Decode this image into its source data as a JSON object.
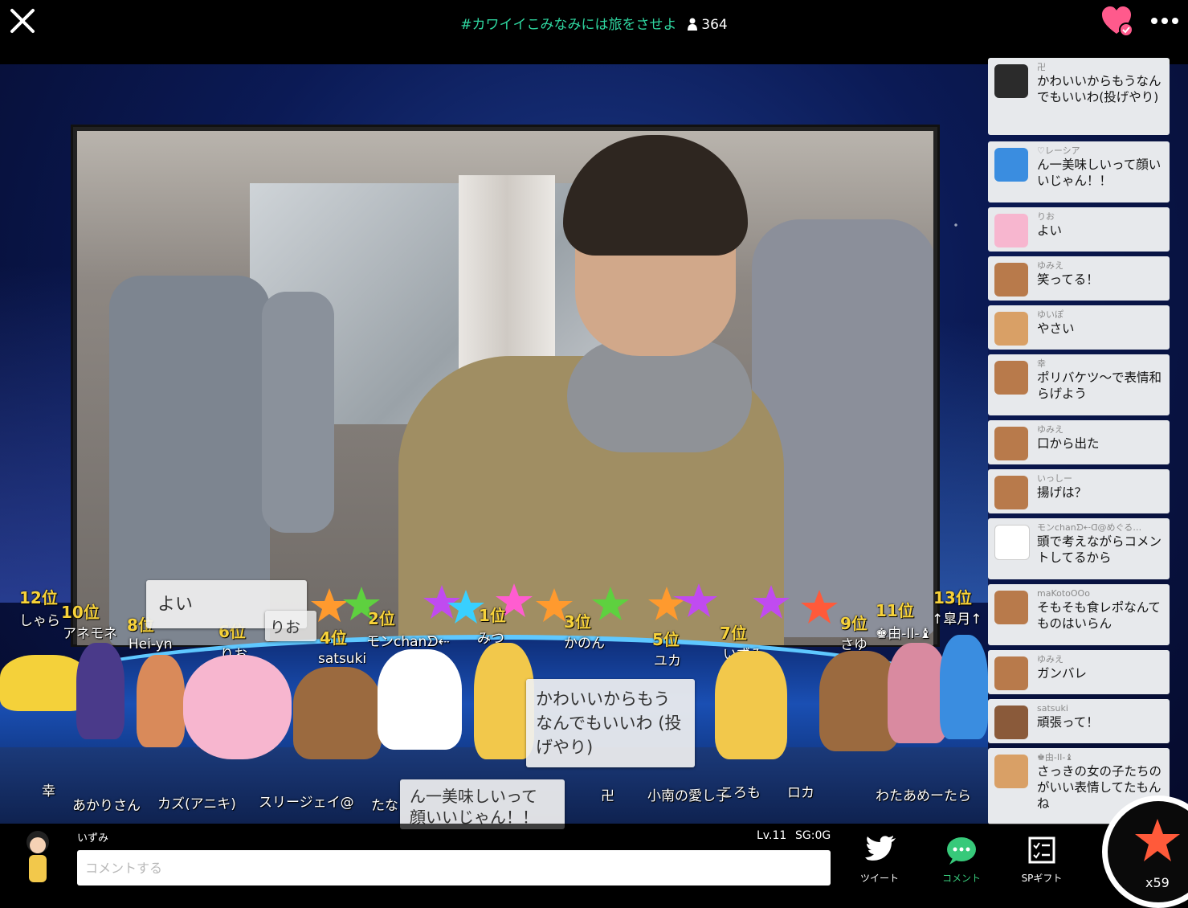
{
  "header": {
    "title": "#カワイイこみなみには旅をさせよ",
    "viewer_count": "364"
  },
  "comments": [
    {
      "name": "卍",
      "text": "かわいいからもうなんでもいいわ(投げやり)",
      "avatar": "sushi-avatar",
      "color": "#2b2b2b"
    },
    {
      "name": "♡レーシア",
      "text": "ん一美味しいって顔いいじゃん！！",
      "avatar": "penguin-avatar",
      "color": "#3a8de0"
    },
    {
      "name": "りお",
      "text": "よい",
      "avatar": "pig-avatar",
      "color": "#f7b6cf"
    },
    {
      "name": "ゆみえ",
      "text": "笑ってる！",
      "avatar": "boy-avatar",
      "color": "#b87a4b"
    },
    {
      "name": "ゆいぽ",
      "text": "やさい",
      "avatar": "girl-avatar",
      "color": "#d9a066"
    },
    {
      "name": "幸",
      "text": "ポリバケツ〜で表情和らげよう",
      "avatar": "boy-avatar",
      "color": "#b87a4b"
    },
    {
      "name": "ゆみえ",
      "text": "口から出た",
      "avatar": "boy-avatar",
      "color": "#b87a4b"
    },
    {
      "name": "いっしー",
      "text": "揚げは？",
      "avatar": "boy-avatar",
      "color": "#b87a4b"
    },
    {
      "name": "モンchanᗤ⇠ᗡ@めぐる…",
      "text": "頭で考えながらコメントしてるから",
      "avatar": "cat-king-avatar",
      "color": "#ffffff"
    },
    {
      "name": "maKotoOOo",
      "text": "そもそも食レポなんてものはいらん",
      "avatar": "boy-avatar",
      "color": "#b87a4b"
    },
    {
      "name": "ゆみえ",
      "text": "ガンバレ",
      "avatar": "boy-avatar",
      "color": "#b87a4b"
    },
    {
      "name": "satsuki",
      "text": "頑張って！",
      "avatar": "painter-avatar",
      "color": "#8a5a3a"
    },
    {
      "name": "♚由-ΙΙ-♝",
      "text": "さっきの女の子たちのがいい表情してたもんね",
      "avatar": "girl-avatar",
      "color": "#d9a066"
    }
  ],
  "ranking": [
    {
      "rank": "12位",
      "name": "しゃら"
    },
    {
      "rank": "10位",
      "name": "アネモネ"
    },
    {
      "rank": "8位",
      "name": "Hei-yn"
    },
    {
      "rank": "6位",
      "name": "りお"
    },
    {
      "rank": "4位",
      "name": "satsuki"
    },
    {
      "rank": "2位",
      "name": "モンchanᗤ⇠"
    },
    {
      "rank": "1位",
      "name": "みつ"
    },
    {
      "rank": "3位",
      "name": "かのん"
    },
    {
      "rank": "5位",
      "name": "ユカ"
    },
    {
      "rank": "7位",
      "name": "いずみ"
    },
    {
      "rank": "9位",
      "name": "さゆ"
    },
    {
      "rank": "11位",
      "name": "♚由-ΙΙ-♝"
    },
    {
      "rank": "13位",
      "name": "↑皐月↑"
    }
  ],
  "floating_bubbles": {
    "yoi": "よい",
    "rio_partial": "りお",
    "kawaii": "かわいいからもう なんでもいいわ (投げやり)",
    "oishii": "ん一美味しいって 顔いいじゃん！！"
  },
  "floor_names": {
    "sachi": "幸",
    "akari": "あかりさん",
    "kazu": "カズ(アニキ)",
    "sleeve": "スリージェイ@",
    "tana": "たな",
    "manji": "卍",
    "kominami": "小南の愛し子",
    "koromo": "ころも",
    "roka": "ロカ",
    "watatatara": "わたあめーたら"
  },
  "footer": {
    "user_name": "いずみ",
    "level": "Lv.11",
    "sg": "SG:0G",
    "comment_placeholder": "コメントする",
    "tweet_label": "ツイート",
    "comment_label": "コメント",
    "sp_gift_label": "SPギフト",
    "star_count": "x59"
  },
  "colors": {
    "accent_green": "#2fd6a0",
    "rank_yellow": "#f7d23a",
    "heart_pink": "#ff5a8c",
    "comment_green": "#37c97a"
  }
}
